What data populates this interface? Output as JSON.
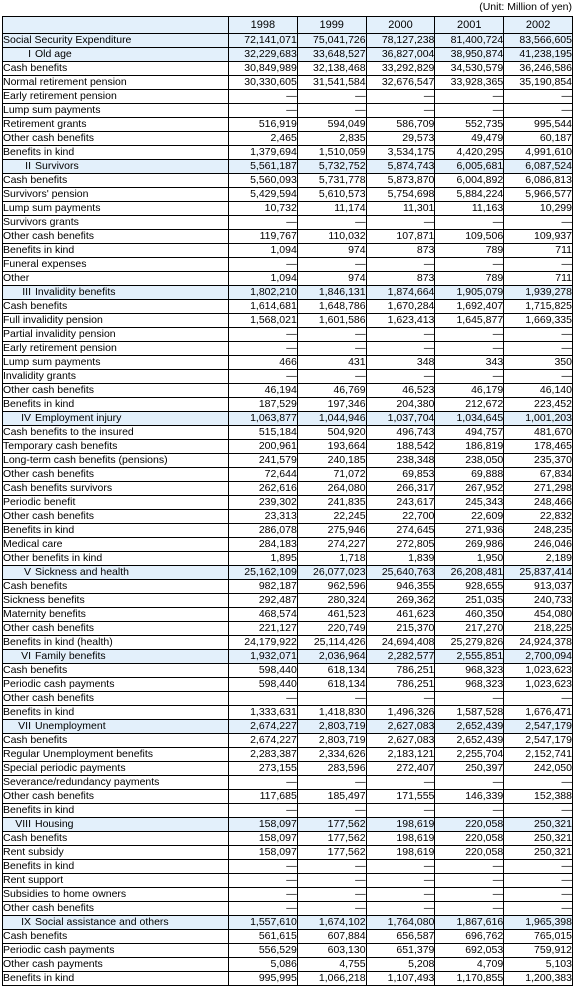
{
  "unit_note": "(Unit: Million of yen)",
  "table": {
    "corner_header": "",
    "year_headers": [
      "1998",
      "1999",
      "2000",
      "2001",
      "2002"
    ],
    "dash": "—",
    "rows": [
      {
        "roman": "",
        "label": "Social Security Expenditure",
        "indent": 0,
        "highlight": true,
        "values": [
          "72,141,071",
          "75,041,726",
          "78,127,238",
          "81,400,724",
          "83,566,605"
        ]
      },
      {
        "roman": "I",
        "label": "Old age",
        "indent": 1,
        "highlight": true,
        "values": [
          "32,229,683",
          "33,648,527",
          "36,827,004",
          "38,950,874",
          "41,238,195"
        ]
      },
      {
        "roman": "",
        "label": "Cash benefits",
        "indent": 2,
        "highlight": false,
        "values": [
          "30,849,989",
          "32,138,468",
          "33,292,829",
          "34,530,579",
          "36,246,586"
        ]
      },
      {
        "roman": "",
        "label": "Normal retirement pension",
        "indent": 3,
        "highlight": false,
        "values": [
          "30,330,605",
          "31,541,584",
          "32,676,547",
          "33,928,365",
          "35,190,854"
        ]
      },
      {
        "roman": "",
        "label": "Early retirement pension",
        "indent": 3,
        "highlight": false,
        "values": [
          "—",
          "—",
          "—",
          "—",
          "—"
        ]
      },
      {
        "roman": "",
        "label": "Lump sum payments",
        "indent": 3,
        "highlight": false,
        "values": [
          "—",
          "—",
          "—",
          "—",
          "—"
        ]
      },
      {
        "roman": "",
        "label": "Retirement grants",
        "indent": 3,
        "highlight": false,
        "values": [
          "516,919",
          "594,049",
          "586,709",
          "552,735",
          "995,544"
        ]
      },
      {
        "roman": "",
        "label": "Other cash benefits",
        "indent": 3,
        "highlight": false,
        "values": [
          "2,465",
          "2,835",
          "29,573",
          "49,479",
          "60,187"
        ]
      },
      {
        "roman": "",
        "label": "Benefits in kind",
        "indent": 2,
        "highlight": false,
        "values": [
          "1,379,694",
          "1,510,059",
          "3,534,175",
          "4,420,295",
          "4,991,610"
        ]
      },
      {
        "roman": "II",
        "label": "Survivors",
        "indent": 1,
        "highlight": true,
        "values": [
          "5,561,187",
          "5,732,752",
          "5,874,743",
          "6,005,681",
          "6,087,524"
        ]
      },
      {
        "roman": "",
        "label": "Cash benefits",
        "indent": 2,
        "highlight": false,
        "values": [
          "5,560,093",
          "5,731,778",
          "5,873,870",
          "6,004,892",
          "6,086,813"
        ]
      },
      {
        "roman": "",
        "label": "Survivors' pension",
        "indent": 3,
        "highlight": false,
        "values": [
          "5,429,594",
          "5,610,573",
          "5,754,698",
          "5,884,224",
          "5,966,577"
        ]
      },
      {
        "roman": "",
        "label": "Lump sum payments",
        "indent": 3,
        "highlight": false,
        "values": [
          "10,732",
          "11,174",
          "11,301",
          "11,163",
          "10,299"
        ]
      },
      {
        "roman": "",
        "label": "Survivors grants",
        "indent": 3,
        "highlight": false,
        "values": [
          "—",
          "—",
          "—",
          "—",
          "—"
        ]
      },
      {
        "roman": "",
        "label": "Other cash benefits",
        "indent": 3,
        "highlight": false,
        "values": [
          "119,767",
          "110,032",
          "107,871",
          "109,506",
          "109,937"
        ]
      },
      {
        "roman": "",
        "label": "Benefits in kind",
        "indent": 2,
        "highlight": false,
        "values": [
          "1,094",
          "974",
          "873",
          "789",
          "711"
        ]
      },
      {
        "roman": "",
        "label": "Funeral expenses",
        "indent": 3,
        "highlight": false,
        "values": [
          "—",
          "—",
          "—",
          "—",
          "—"
        ]
      },
      {
        "roman": "",
        "label": "Other",
        "indent": 3,
        "highlight": false,
        "values": [
          "1,094",
          "974",
          "873",
          "789",
          "711"
        ]
      },
      {
        "roman": "III",
        "label": "Invalidity benefits",
        "indent": 1,
        "highlight": true,
        "values": [
          "1,802,210",
          "1,846,131",
          "1,874,664",
          "1,905,079",
          "1,939,278"
        ]
      },
      {
        "roman": "",
        "label": "Cash benefits",
        "indent": 2,
        "highlight": false,
        "values": [
          "1,614,681",
          "1,648,786",
          "1,670,284",
          "1,692,407",
          "1,715,825"
        ]
      },
      {
        "roman": "",
        "label": "Full invalidity pension",
        "indent": 3,
        "highlight": false,
        "values": [
          "1,568,021",
          "1,601,586",
          "1,623,413",
          "1,645,877",
          "1,669,335"
        ]
      },
      {
        "roman": "",
        "label": "Partial invalidity pension",
        "indent": 3,
        "highlight": false,
        "values": [
          "—",
          "—",
          "—",
          "—",
          "—"
        ]
      },
      {
        "roman": "",
        "label": "Early retirement pension",
        "indent": 3,
        "highlight": false,
        "values": [
          "—",
          "—",
          "—",
          "—",
          "—"
        ]
      },
      {
        "roman": "",
        "label": "Lump sum payments",
        "indent": 3,
        "highlight": false,
        "values": [
          "466",
          "431",
          "348",
          "343",
          "350"
        ]
      },
      {
        "roman": "",
        "label": "Invalidity grants",
        "indent": 3,
        "highlight": false,
        "values": [
          "—",
          "—",
          "—",
          "—",
          "—"
        ]
      },
      {
        "roman": "",
        "label": "Other cash benefits",
        "indent": 3,
        "highlight": false,
        "values": [
          "46,194",
          "46,769",
          "46,523",
          "46,179",
          "46,140"
        ]
      },
      {
        "roman": "",
        "label": "Benefits in kind",
        "indent": 2,
        "highlight": false,
        "values": [
          "187,529",
          "197,346",
          "204,380",
          "212,672",
          "223,452"
        ]
      },
      {
        "roman": "IV",
        "label": "Employment injury",
        "indent": 1,
        "highlight": true,
        "values": [
          "1,063,877",
          "1,044,946",
          "1,037,704",
          "1,034,645",
          "1,001,203"
        ]
      },
      {
        "roman": "",
        "label": "Cash benefits to the insured",
        "indent": 2,
        "highlight": false,
        "values": [
          "515,184",
          "504,920",
          "496,743",
          "494,757",
          "481,670"
        ]
      },
      {
        "roman": "",
        "label": "Temporary cash benefits",
        "indent": 3,
        "highlight": false,
        "values": [
          "200,961",
          "193,664",
          "188,542",
          "186,819",
          "178,465"
        ]
      },
      {
        "roman": "",
        "label": "Long-term cash benefits (pensions)",
        "indent": 3,
        "highlight": false,
        "values": [
          "241,579",
          "240,185",
          "238,348",
          "238,050",
          "235,370"
        ]
      },
      {
        "roman": "",
        "label": "Other cash benefits",
        "indent": 3,
        "highlight": false,
        "values": [
          "72,644",
          "71,072",
          "69,853",
          "69,888",
          "67,834"
        ]
      },
      {
        "roman": "",
        "label": "Cash benefits survivors",
        "indent": 2,
        "highlight": false,
        "values": [
          "262,616",
          "264,080",
          "266,317",
          "267,952",
          "271,298"
        ]
      },
      {
        "roman": "",
        "label": "Periodic benefit",
        "indent": 3,
        "highlight": false,
        "values": [
          "239,302",
          "241,835",
          "243,617",
          "245,343",
          "248,466"
        ]
      },
      {
        "roman": "",
        "label": "Other cash benefits",
        "indent": 3,
        "highlight": false,
        "values": [
          "23,313",
          "22,245",
          "22,700",
          "22,609",
          "22,832"
        ]
      },
      {
        "roman": "",
        "label": "Benefits in kind",
        "indent": 2,
        "highlight": false,
        "values": [
          "286,078",
          "275,946",
          "274,645",
          "271,936",
          "248,235"
        ]
      },
      {
        "roman": "",
        "label": "Medical care",
        "indent": 3,
        "highlight": false,
        "values": [
          "284,183",
          "274,227",
          "272,805",
          "269,986",
          "246,046"
        ]
      },
      {
        "roman": "",
        "label": "Other benefits in kind",
        "indent": 3,
        "highlight": false,
        "values": [
          "1,895",
          "1,718",
          "1,839",
          "1,950",
          "2,189"
        ]
      },
      {
        "roman": "V",
        "label": "Sickness and health",
        "indent": 1,
        "highlight": true,
        "values": [
          "25,162,109",
          "26,077,023",
          "25,640,763",
          "26,208,481",
          "25,837,414"
        ]
      },
      {
        "roman": "",
        "label": "Cash benefits",
        "indent": 2,
        "highlight": false,
        "values": [
          "982,187",
          "962,596",
          "946,355",
          "928,655",
          "913,037"
        ]
      },
      {
        "roman": "",
        "label": "Sickness benefits",
        "indent": 3,
        "highlight": false,
        "values": [
          "292,487",
          "280,324",
          "269,362",
          "251,035",
          "240,733"
        ]
      },
      {
        "roman": "",
        "label": "Maternity benefits",
        "indent": 3,
        "highlight": false,
        "values": [
          "468,574",
          "461,523",
          "461,623",
          "460,350",
          "454,080"
        ]
      },
      {
        "roman": "",
        "label": "Other cash benefits",
        "indent": 3,
        "highlight": false,
        "values": [
          "221,127",
          "220,749",
          "215,370",
          "217,270",
          "218,225"
        ]
      },
      {
        "roman": "",
        "label": "Benefits in kind (health)",
        "indent": 2,
        "highlight": false,
        "values": [
          "24,179,922",
          "25,114,426",
          "24,694,408",
          "25,279,826",
          "24,924,378"
        ]
      },
      {
        "roman": "VI",
        "label": "Family benefits",
        "indent": 1,
        "highlight": true,
        "values": [
          "1,932,071",
          "2,036,964",
          "2,282,577",
          "2,555,851",
          "2,700,094"
        ]
      },
      {
        "roman": "",
        "label": "Cash benefits",
        "indent": 2,
        "highlight": false,
        "values": [
          "598,440",
          "618,134",
          "786,251",
          "968,323",
          "1,023,623"
        ]
      },
      {
        "roman": "",
        "label": "Periodic cash payments",
        "indent": 3,
        "highlight": false,
        "values": [
          "598,440",
          "618,134",
          "786,251",
          "968,323",
          "1,023,623"
        ]
      },
      {
        "roman": "",
        "label": "Other cash benefits",
        "indent": 3,
        "highlight": false,
        "values": [
          "—",
          "—",
          "—",
          "—",
          "—"
        ]
      },
      {
        "roman": "",
        "label": "Benefits in kind",
        "indent": 2,
        "highlight": false,
        "values": [
          "1,333,631",
          "1,418,830",
          "1,496,326",
          "1,587,528",
          "1,676,471"
        ]
      },
      {
        "roman": "VII",
        "label": "Unemployment",
        "indent": 1,
        "highlight": true,
        "values": [
          "2,674,227",
          "2,803,719",
          "2,627,083",
          "2,652,439",
          "2,547,179"
        ]
      },
      {
        "roman": "",
        "label": "Cash benefits",
        "indent": 2,
        "highlight": false,
        "values": [
          "2,674,227",
          "2,803,719",
          "2,627,083",
          "2,652,439",
          "2,547,179"
        ]
      },
      {
        "roman": "",
        "label": "Regular Unemployment benefits",
        "indent": 3,
        "highlight": false,
        "values": [
          "2,283,387",
          "2,334,626",
          "2,183,121",
          "2,255,704",
          "2,152,741"
        ]
      },
      {
        "roman": "",
        "label": "Special periodic payments",
        "indent": 3,
        "highlight": false,
        "values": [
          "273,155",
          "283,596",
          "272,407",
          "250,397",
          "242,050"
        ]
      },
      {
        "roman": "",
        "label": "Severance/redundancy payments",
        "indent": 3,
        "highlight": false,
        "values": [
          "—",
          "—",
          "—",
          "—",
          "—"
        ]
      },
      {
        "roman": "",
        "label": "Other cash benefits",
        "indent": 3,
        "highlight": false,
        "values": [
          "117,685",
          "185,497",
          "171,555",
          "146,339",
          "152,388"
        ]
      },
      {
        "roman": "",
        "label": "Benefits in kind",
        "indent": 2,
        "highlight": false,
        "values": [
          "—",
          "—",
          "—",
          "—",
          "—"
        ]
      },
      {
        "roman": "VIII",
        "label": "Housing",
        "indent": 1,
        "highlight": true,
        "values": [
          "158,097",
          "177,562",
          "198,619",
          "220,058",
          "250,321"
        ]
      },
      {
        "roman": "",
        "label": "Cash benefits",
        "indent": 2,
        "highlight": false,
        "values": [
          "158,097",
          "177,562",
          "198,619",
          "220,058",
          "250,321"
        ]
      },
      {
        "roman": "",
        "label": "Rent subsidy",
        "indent": 3,
        "highlight": false,
        "values": [
          "158,097",
          "177,562",
          "198,619",
          "220,058",
          "250,321"
        ]
      },
      {
        "roman": "",
        "label": "Benefits in kind",
        "indent": 2,
        "highlight": false,
        "values": [
          "—",
          "—",
          "—",
          "—",
          "—"
        ]
      },
      {
        "roman": "",
        "label": "Rent support",
        "indent": 3,
        "highlight": false,
        "values": [
          "—",
          "—",
          "—",
          "—",
          "—"
        ]
      },
      {
        "roman": "",
        "label": "Subsidies to home owners",
        "indent": 3,
        "highlight": false,
        "values": [
          "—",
          "—",
          "—",
          "—",
          "—"
        ]
      },
      {
        "roman": "",
        "label": "Other cash benefits",
        "indent": 3,
        "highlight": false,
        "values": [
          "—",
          "—",
          "—",
          "—",
          "—"
        ]
      },
      {
        "roman": "IX",
        "label": "Social assistance and others",
        "indent": 1,
        "highlight": true,
        "values": [
          "1,557,610",
          "1,674,102",
          "1,764,080",
          "1,867,616",
          "1,965,398"
        ]
      },
      {
        "roman": "",
        "label": "Cash benefits",
        "indent": 2,
        "highlight": false,
        "values": [
          "561,615",
          "607,884",
          "656,587",
          "696,762",
          "765,015"
        ]
      },
      {
        "roman": "",
        "label": "Periodic cash payments",
        "indent": 3,
        "highlight": false,
        "values": [
          "556,529",
          "603,130",
          "651,379",
          "692,053",
          "759,912"
        ]
      },
      {
        "roman": "",
        "label": "Other cash payments",
        "indent": 3,
        "highlight": false,
        "values": [
          "5,086",
          "4,755",
          "5,208",
          "4,709",
          "5,103"
        ]
      },
      {
        "roman": "",
        "label": "Benefits in kind",
        "indent": 2,
        "highlight": false,
        "values": [
          "995,995",
          "1,066,218",
          "1,107,493",
          "1,170,855",
          "1,200,383"
        ]
      }
    ]
  }
}
